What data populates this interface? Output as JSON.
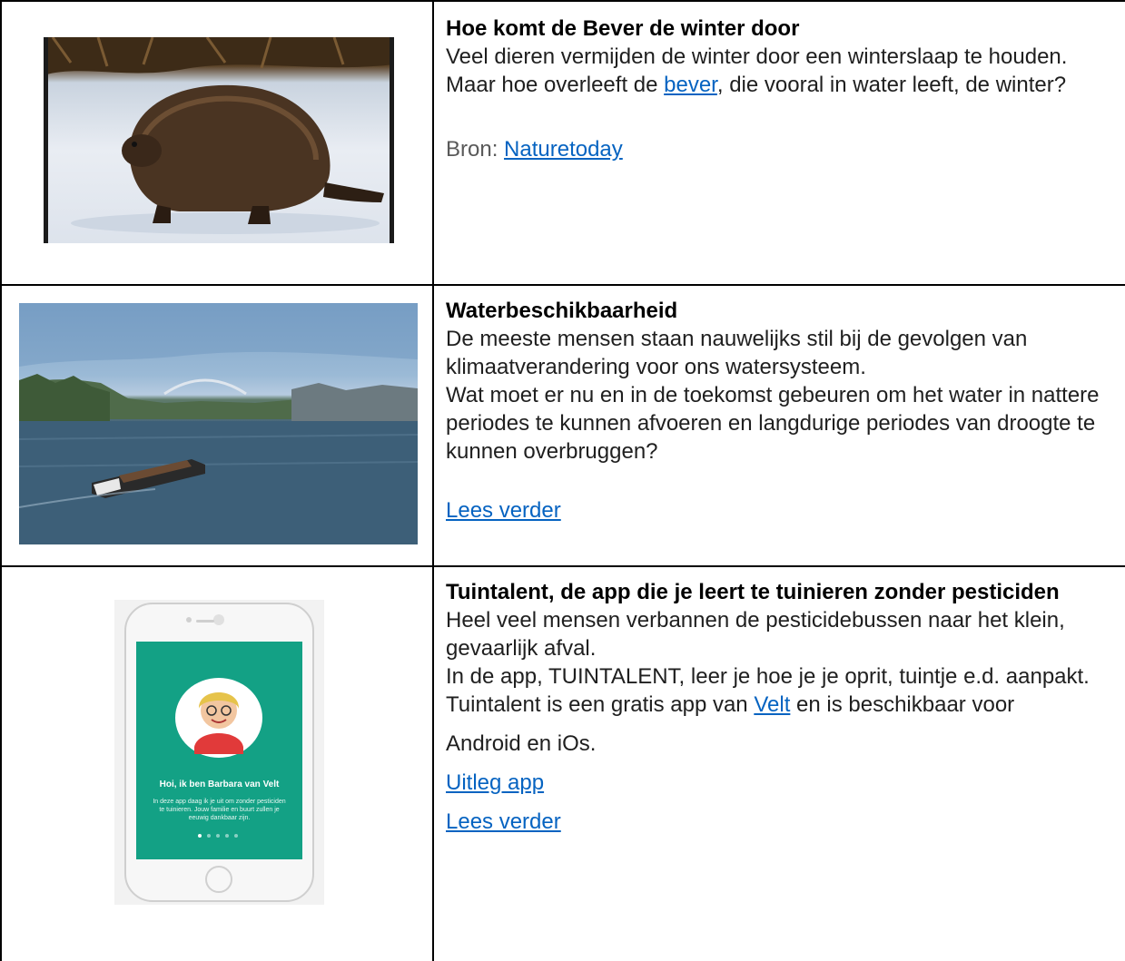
{
  "rows": [
    {
      "image_icon": "beaver-photo",
      "title": "Hoe komt de Bever de winter door",
      "lines": [
        "Veel dieren vermijden de winter door een winterslaap te houden.",
        "Maar hoe overleeft de ",
        ", die vooral in water leeft, de winter?"
      ],
      "link_bever": "bever",
      "source_label": "Bron: ",
      "source_link": "Naturetoday"
    },
    {
      "image_icon": "river-photo",
      "title": "Waterbeschikbaarheid",
      "para1": "De meeste mensen staan nauwelijks stil bij de gevolgen van klimaatverandering voor ons watersysteem.",
      "para2": "Wat moet er nu en in de toekomst gebeuren om het water in nattere periodes te kunnen afvoeren en langdurige periodes van droogte te kunnen overbruggen?",
      "link": "Lees verder"
    },
    {
      "image_icon": "phone-app-screenshot",
      "phone_text_title": "Hoi, ik ben Barbara van Velt",
      "phone_text_body": "In deze app daag ik je uit om zonder pesticiden te tuinieren. Jouw familie en buurt zullen je eeuwig dankbaar zijn.",
      "title": "Tuintalent, de app die je leert te tuinieren zonder pesticiden",
      "para1": "Heel veel mensen verbannen de pesticidebussen naar het klein, gevaarlijk afval.",
      "para2": "In de app, TUINTALENT, leer je hoe je je oprit, tuintje e.d. aanpakt.",
      "para3_pre": "Tuintalent is een gratis app van ",
      "para3_link": "Velt",
      "para3_post": " en is beschikbaar voor",
      "para4": "Android en iOs.",
      "link1": "Uitleg app",
      "link2": "Lees verder"
    }
  ],
  "colors": {
    "link": "#0563c1",
    "border": "#000000",
    "phone_screen": "#13a185"
  }
}
